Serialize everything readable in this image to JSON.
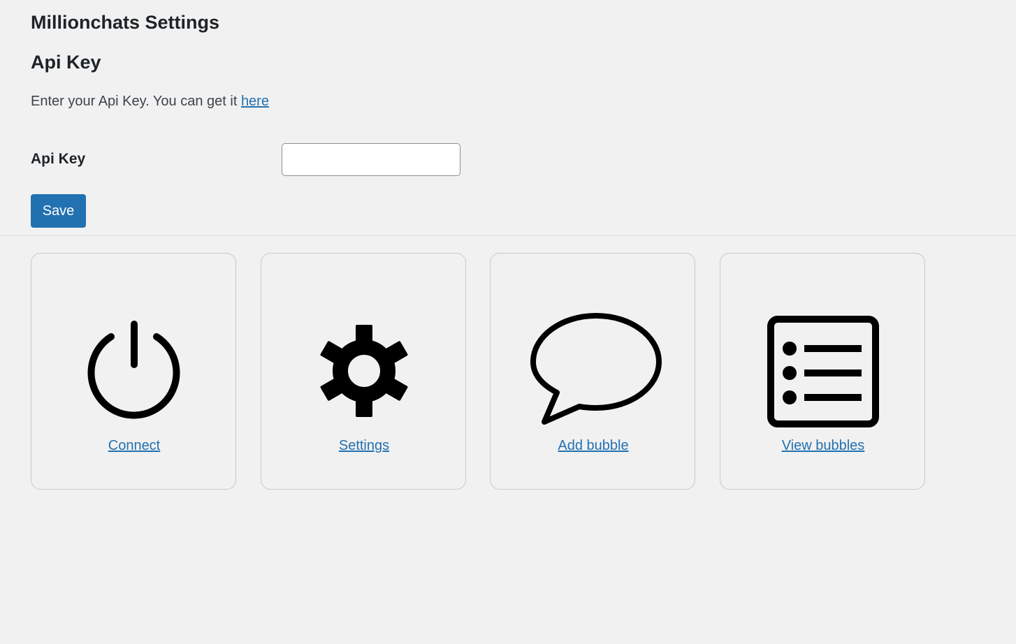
{
  "page": {
    "title": "Millionchats Settings"
  },
  "api_section": {
    "title": "Api Key",
    "description_prefix": "Enter your Api Key. You can get it ",
    "description_link": "here",
    "field_label": "Api Key",
    "input_value": "",
    "input_placeholder": "",
    "save_label": "Save"
  },
  "cards": [
    {
      "label": "Connect",
      "icon": "power-icon"
    },
    {
      "label": "Settings",
      "icon": "gear-icon"
    },
    {
      "label": "Add bubble",
      "icon": "speech-bubble-icon"
    },
    {
      "label": "View bubbles",
      "icon": "list-icon"
    }
  ],
  "colors": {
    "accent": "#2271b1",
    "background": "#f1f1f1",
    "icon": "#000000"
  }
}
